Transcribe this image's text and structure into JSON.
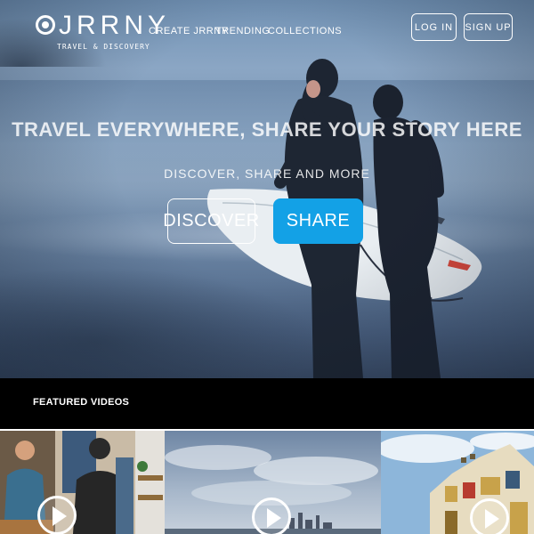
{
  "brand": {
    "name": "JRRNY",
    "tagline": "TRAVEL & DISCOVERY",
    "logo_icon": "eye-icon"
  },
  "nav": {
    "links": [
      "CREATE JRRNY",
      "TRENDING",
      "COLLECTIONS"
    ],
    "login_label": "LOG IN",
    "signup_label": "SIGN UP"
  },
  "hero": {
    "headline": "TRAVEL EVERYWHERE, SHARE YOUR STORY HERE",
    "subheadline": "DISCOVER, SHARE AND MORE",
    "discover_label": "DISCOVER",
    "share_label": "SHARE"
  },
  "featured": {
    "title": "FEATURED VIDEOS",
    "videos": [
      {
        "thumbnail": "people-indoors",
        "play_icon": "play-icon"
      },
      {
        "thumbnail": "city-skyline",
        "play_icon": "play-icon"
      },
      {
        "thumbnail": "building",
        "play_icon": "play-icon"
      }
    ]
  },
  "colors": {
    "accent": "#13a1e6",
    "featured_bar": "#000000",
    "hero_tint": "#7a95b3"
  }
}
